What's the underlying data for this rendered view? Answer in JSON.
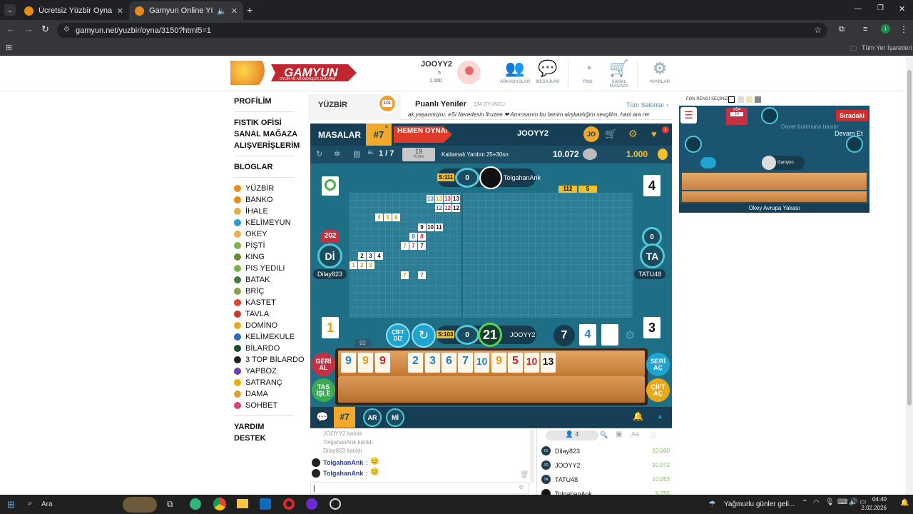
{
  "browser": {
    "tabs": [
      {
        "title": "Ücretsiz Yüzbir Oyna - Salon Li"
      },
      {
        "title": "Gamyun Online Yüzbir"
      }
    ],
    "new_tab": "+",
    "url": "gamyun.net/yuzbir/oyna/3150?html5=1",
    "bookmarks_label": "Tüm Yer İşaretleri"
  },
  "header": {
    "logo": "GAMYUN",
    "logo_sub": "OYUN VE ARKADAŞLIK DÜNYASI",
    "username": "JOOYY2",
    "coins": "5",
    "points": "1.000",
    "nav": [
      {
        "label": "ARKADAŞLAR",
        "icon": "friends-icon"
      },
      {
        "label": "MESAJLAR",
        "icon": "messages-icon"
      },
      {
        "label": "FMO",
        "icon": "fmo-icon"
      },
      {
        "label": "SANAL MAĞAZA",
        "icon": "cart-icon"
      },
      {
        "label": "AYARLAR",
        "icon": "gear-icon"
      }
    ]
  },
  "sidebar": {
    "profile": "PROFİLİM",
    "links": [
      "FISTIK OFİSİ",
      "SANAL MAĞAZA",
      "ALIŞVERİŞLERİM"
    ],
    "blogs": "BLOGLAR",
    "games": [
      {
        "label": "YÜZBİR",
        "color": "#e98b1b"
      },
      {
        "label": "BANKO",
        "color": "#e98b1b"
      },
      {
        "label": "İHALE",
        "color": "#e0b24a"
      },
      {
        "label": "KELİMEYUN",
        "color": "#2a9ad3"
      },
      {
        "label": "OKEY",
        "color": "#e9b04b"
      },
      {
        "label": "PİŞTİ",
        "color": "#7ab24a"
      },
      {
        "label": "KING",
        "color": "#6e8a2f"
      },
      {
        "label": "PIS YEDILI",
        "color": "#7ab24a"
      },
      {
        "label": "BATAK",
        "color": "#3e7d3a"
      },
      {
        "label": "BRİÇ",
        "color": "#8aa04a"
      },
      {
        "label": "KASTET",
        "color": "#d8492c"
      },
      {
        "label": "TAVLA",
        "color": "#c43a2f"
      },
      {
        "label": "DOMİNO",
        "color": "#e9a81b"
      },
      {
        "label": "KELİMEKULE",
        "color": "#2a6cb3"
      },
      {
        "label": "BİLARDO",
        "color": "#1d4d2a"
      },
      {
        "label": "3 TOP BİLARDO",
        "color": "#222222"
      },
      {
        "label": "YAPBOZ",
        "color": "#6a3fb5"
      },
      {
        "label": "SATRANÇ",
        "color": "#e5b400"
      },
      {
        "label": "DAMA",
        "color": "#d9a233"
      },
      {
        "label": "SOHBET",
        "color": "#d6407b"
      }
    ],
    "help": "YARDIM",
    "support": "DESTEK"
  },
  "room": {
    "game_title": "YÜZBİR",
    "room_name": "Puanlı Yeniler",
    "players_online": "134 OYUNCU",
    "all_rooms": "Tüm Salonlar",
    "marquee": "ak yaşanmıyor. eSi Neredesin firuzee ❤ Anımsarım bu benim alışkanlığım sevgilim, hani ara rer"
  },
  "game": {
    "tables_label": "MASALAR",
    "table_no": "#7",
    "play_now": "HEMEN OYNA!",
    "username": "JOOYY2",
    "avatar_initials": "JO",
    "notif_count": "1",
    "hand_label": "EL",
    "hand": "1 / 7",
    "points": "19",
    "points_label": "PUAN",
    "mode": "Katlamalı Yardım 25+30sn",
    "balance": "10.072",
    "chips": "1.000",
    "top_player": {
      "name": "TolgahanAnk",
      "seat": "S:111",
      "score": "0"
    },
    "left_player": {
      "name": "Dilay823",
      "initials": "Dİ",
      "score": "202"
    },
    "right_player": {
      "name": "TATU48",
      "initials": "TA",
      "score": "0"
    },
    "me": {
      "name": "JOOYY2",
      "seat": "S:103",
      "score": "0",
      "timer": "21"
    },
    "board_header": [
      "112",
      "5"
    ],
    "left_card": "1",
    "right_card": "3",
    "top_right_card": "4",
    "pile_tiles": [
      "7",
      "4"
    ],
    "deck_count": "92",
    "double_button": "ÇİFT DİZ",
    "rack": [
      {
        "v": "9",
        "c": "blue"
      },
      {
        "v": "9",
        "c": "yellow"
      },
      {
        "v": "9",
        "c": "red"
      },
      {
        "v": "2",
        "c": "blue"
      },
      {
        "v": "3",
        "c": "blue"
      },
      {
        "v": "6",
        "c": "blue"
      },
      {
        "v": "7",
        "c": "blue"
      },
      {
        "v": "10",
        "c": "blue"
      },
      {
        "v": "9",
        "c": "yellow"
      },
      {
        "v": "5",
        "c": "red"
      },
      {
        "v": "10",
        "c": "red"
      },
      {
        "v": "13",
        "c": "black"
      }
    ],
    "rack_buttons": {
      "undo": "GERİ AL",
      "discard": "TAŞ İŞLE",
      "series": "SERİ AÇ",
      "pairs": "ÇİFT AÇ"
    },
    "board_tiles": [
      {
        "v": "13",
        "c": "blue"
      },
      {
        "v": "13",
        "c": "yellow"
      },
      {
        "v": "13",
        "c": "red"
      },
      {
        "v": "13",
        "c": "black"
      },
      {
        "v": "12",
        "c": "blue"
      },
      {
        "v": "12",
        "c": "red"
      },
      {
        "v": "12",
        "c": "black"
      },
      {
        "v": "4",
        "c": "yellow"
      },
      {
        "v": "5",
        "c": "yellow"
      },
      {
        "v": "6",
        "c": "yellow"
      },
      {
        "v": "9",
        "c": "black"
      },
      {
        "v": "10",
        "c": "black"
      },
      {
        "v": "11",
        "c": "black"
      },
      {
        "v": "8",
        "c": "blue"
      },
      {
        "v": "8",
        "c": "red"
      },
      {
        "v": "7",
        "c": "yellow"
      },
      {
        "v": "7",
        "c": "red"
      },
      {
        "v": "7",
        "c": "black"
      },
      {
        "v": "2",
        "c": "black"
      },
      {
        "v": "3",
        "c": "black"
      },
      {
        "v": "4",
        "c": "black"
      },
      {
        "v": "1",
        "c": "yellow"
      },
      {
        "v": "2",
        "c": "yellow"
      },
      {
        "v": "3",
        "c": "yellow"
      },
      {
        "v": "7",
        "c": "yellow"
      },
      {
        "v": "7",
        "c": "blue"
      }
    ]
  },
  "chatbar": {
    "table": "#7",
    "ar": "AR",
    "mi": "Mİ"
  },
  "chat": {
    "system": [
      "JOOYY2 katıldı",
      "TolgahanAnk katıldı",
      "Dilay823 katıldı"
    ],
    "messages": [
      {
        "user": "TolgahanAnk",
        "text": ":"
      },
      {
        "user": "TolgahanAnk",
        "text": ":"
      }
    ]
  },
  "player_list": {
    "count": "4",
    "rows": [
      {
        "name": "Dilay823",
        "value": "10.000",
        "initials": "Di"
      },
      {
        "name": "JOOYY2",
        "value": "10.072",
        "initials": "JO"
      },
      {
        "name": "TATU48",
        "value": "10.053",
        "initials": "TA"
      },
      {
        "name": "TolgahanAnk",
        "value": "9.755",
        "initials": ""
      }
    ]
  },
  "right": {
    "bg_color_label": "FON RENGİ SEÇİNİZ:",
    "queue": "Sıradaki",
    "invite": "Davet butonuna basılır",
    "continue": "Devam Et",
    "mini_table": "#54",
    "mini_count": "16",
    "player": "Gamyun",
    "room": "Okey Avrupa Yakası"
  },
  "taskbar": {
    "search": "Ara",
    "weather": "Yağmurlu günler geli...",
    "time": "04:40",
    "date": "2.02.2026"
  }
}
